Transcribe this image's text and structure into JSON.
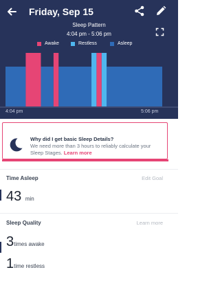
{
  "header": {
    "title": "Friday, Sep 15",
    "back_icon": "arrow-left-icon",
    "share_icon": "share-icon",
    "edit_icon": "pencil-icon"
  },
  "chart_data": {
    "type": "bar",
    "title": "Sleep Pattern",
    "subtitle": "4:04 pm - 5:06 pm",
    "x_start_label": "4:04 pm",
    "x_end_label": "5:06 pm",
    "x_range": [
      "4:04 pm",
      "5:06 pm"
    ],
    "legend": [
      {
        "name": "Awake",
        "color": "#e64575"
      },
      {
        "name": "Restless",
        "color": "#4fb6ee"
      },
      {
        "name": "Asleep",
        "color": "#2f6bb7"
      }
    ],
    "segments": [
      {
        "stage": "Asleep",
        "start_min": 0,
        "end_min": 8
      },
      {
        "stage": "Awake",
        "start_min": 8,
        "end_min": 14
      },
      {
        "stage": "Asleep",
        "start_min": 14,
        "end_min": 19
      },
      {
        "stage": "Awake",
        "start_min": 19,
        "end_min": 21
      },
      {
        "stage": "Asleep",
        "start_min": 21,
        "end_min": 34
      },
      {
        "stage": "Restless",
        "start_min": 34,
        "end_min": 36
      },
      {
        "stage": "Awake",
        "start_min": 36,
        "end_min": 38
      },
      {
        "stage": "Restless",
        "start_min": 38,
        "end_min": 40
      },
      {
        "stage": "Asleep",
        "start_min": 40,
        "end_min": 62
      }
    ],
    "total_minutes": 62
  },
  "info_card": {
    "title": "Why did I get basic Sleep Details?",
    "body": "We need more than 3 hours to reliably calculate your Sleep Stages. ",
    "link": "Learn more",
    "icon": "moon-icon"
  },
  "time_asleep": {
    "label": "Time Asleep",
    "action": "Edit Goal",
    "value": "43",
    "unit": "min"
  },
  "sleep_quality": {
    "label": "Sleep Quality",
    "action": "Learn more",
    "items": [
      {
        "value": "3",
        "unit": "times awake"
      },
      {
        "value": "1",
        "unit": "time restless"
      }
    ]
  },
  "colors": {
    "panel_bg": "#27335a",
    "awake": "#e64575",
    "restless": "#4fb6ee",
    "asleep": "#2f6bb7"
  }
}
